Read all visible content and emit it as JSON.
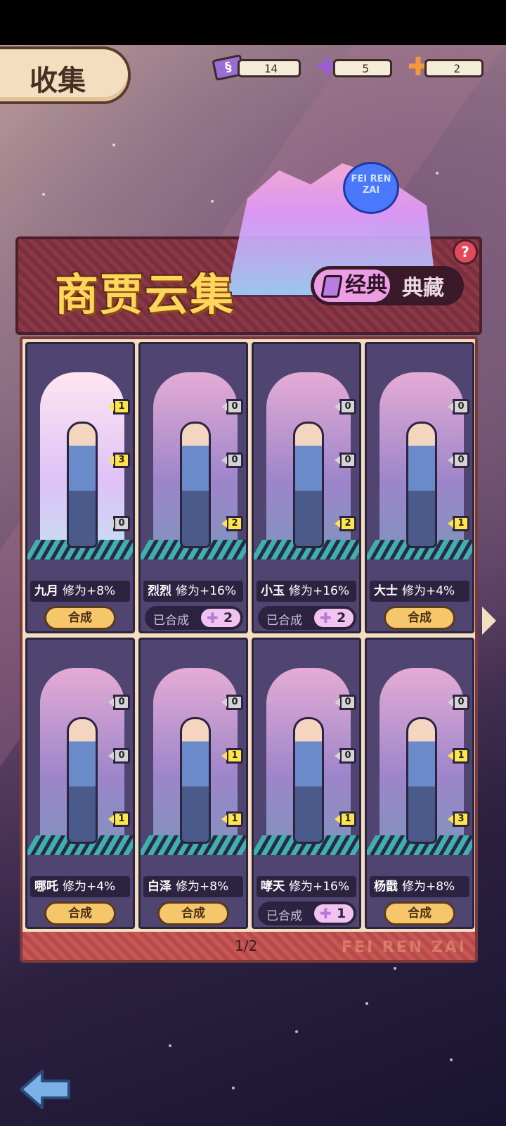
{
  "header": {
    "title": "收集",
    "currencies": [
      {
        "icon": "ticket-icon",
        "value": "14"
      },
      {
        "icon": "purple-puzzle-icon",
        "value": "5"
      },
      {
        "icon": "orange-puzzle-icon",
        "value": "2"
      }
    ]
  },
  "banner": {
    "title": "商贾云集",
    "neon_sign": "FEI REN ZAI",
    "tabs": [
      {
        "label": "经典",
        "active": true
      },
      {
        "label": "典藏",
        "active": false
      }
    ],
    "help": "?"
  },
  "cards": [
    {
      "name": "九月",
      "bonus": "修为+8%",
      "badges": [
        "1",
        "3",
        "0"
      ],
      "action": "合成",
      "composed": false,
      "lit": true
    },
    {
      "name": "烈烈",
      "bonus": "修为+16%",
      "badges": [
        "0",
        "0",
        "2"
      ],
      "composed": true,
      "composed_label": "已合成",
      "pieces": "2"
    },
    {
      "name": "小玉",
      "bonus": "修为+16%",
      "badges": [
        "0",
        "0",
        "2"
      ],
      "composed": true,
      "composed_label": "已合成",
      "pieces": "2"
    },
    {
      "name": "大士",
      "bonus": "修为+4%",
      "badges": [
        "0",
        "0",
        "1"
      ],
      "action": "合成",
      "composed": false
    },
    {
      "name": "哪吒",
      "bonus": "修为+4%",
      "badges": [
        "0",
        "0",
        "1"
      ],
      "action": "合成",
      "composed": false
    },
    {
      "name": "白泽",
      "bonus": "修为+8%",
      "badges": [
        "0",
        "1",
        "1"
      ],
      "action": "合成",
      "composed": false
    },
    {
      "name": "哮天",
      "bonus": "修为+16%",
      "badges": [
        "0",
        "0",
        "1"
      ],
      "composed": true,
      "composed_label": "已合成",
      "pieces": "1"
    },
    {
      "name": "杨戬",
      "bonus": "修为+8%",
      "badges": [
        "0",
        "1",
        "3"
      ],
      "action": "合成",
      "composed": false
    }
  ],
  "pager": {
    "label": "1/2",
    "watermark": "FEI REN ZAI"
  },
  "colors": {
    "accent_gold": "#ffd55c",
    "button": "#f6c66a",
    "card_bg": "#4f4570",
    "panel": "#f3dfc0"
  }
}
